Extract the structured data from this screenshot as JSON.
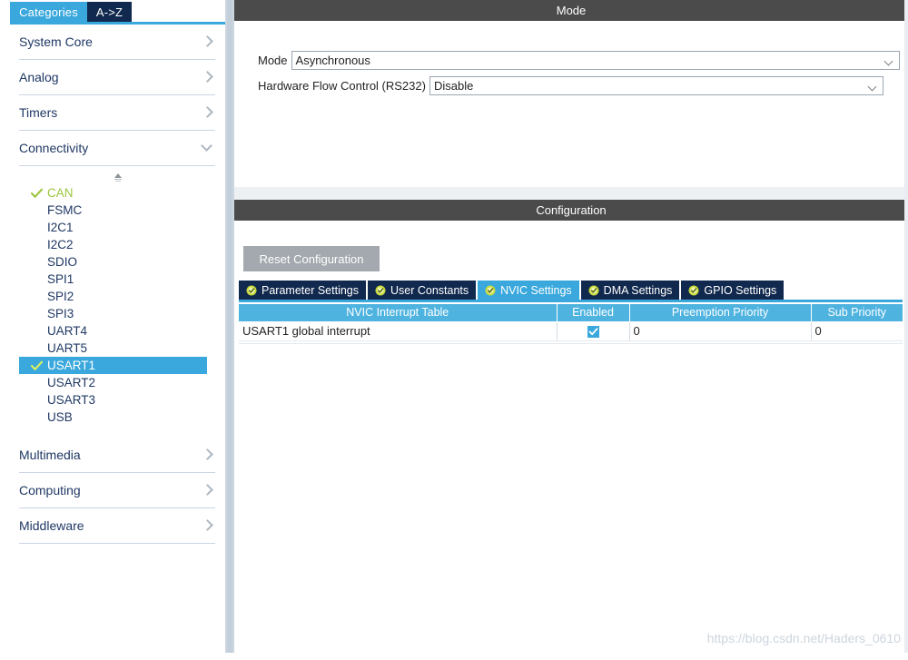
{
  "left_pane": {
    "tabs": [
      {
        "label": "Categories",
        "active": true
      },
      {
        "label": "A->Z",
        "active": false
      }
    ],
    "categories_top": [
      {
        "label": "System Core",
        "expanded": false
      },
      {
        "label": "Analog",
        "expanded": false
      },
      {
        "label": "Timers",
        "expanded": false
      },
      {
        "label": "Connectivity",
        "expanded": true
      }
    ],
    "peripherals": [
      {
        "label": "CAN",
        "state": "configured",
        "selected": false
      },
      {
        "label": "FSMC",
        "state": "none",
        "selected": false
      },
      {
        "label": "I2C1",
        "state": "none",
        "selected": false
      },
      {
        "label": "I2C2",
        "state": "none",
        "selected": false
      },
      {
        "label": "SDIO",
        "state": "none",
        "selected": false
      },
      {
        "label": "SPI1",
        "state": "none",
        "selected": false
      },
      {
        "label": "SPI2",
        "state": "none",
        "selected": false
      },
      {
        "label": "SPI3",
        "state": "none",
        "selected": false
      },
      {
        "label": "UART4",
        "state": "none",
        "selected": false
      },
      {
        "label": "UART5",
        "state": "none",
        "selected": false
      },
      {
        "label": "USART1",
        "state": "configured",
        "selected": true
      },
      {
        "label": "USART2",
        "state": "none",
        "selected": false
      },
      {
        "label": "USART3",
        "state": "none",
        "selected": false
      },
      {
        "label": "USB",
        "state": "none",
        "selected": false
      }
    ],
    "categories_bottom": [
      {
        "label": "Multimedia",
        "expanded": false
      },
      {
        "label": "Computing",
        "expanded": false
      },
      {
        "label": "Middleware",
        "expanded": false
      }
    ],
    "scroll_up_icon": "scroll-up-icon"
  },
  "mode_panel": {
    "title": "Mode",
    "fields": [
      {
        "label": "Mode",
        "value": "Asynchronous"
      },
      {
        "label": "Hardware Flow Control (RS232)",
        "value": "Disable"
      }
    ]
  },
  "config_panel": {
    "title": "Configuration",
    "reset_label": "Reset Configuration",
    "tabs": [
      {
        "label": "Parameter Settings",
        "active": false
      },
      {
        "label": "User Constants",
        "active": false
      },
      {
        "label": "NVIC Settings",
        "active": true
      },
      {
        "label": "DMA Settings",
        "active": false
      },
      {
        "label": "GPIO Settings",
        "active": false
      }
    ],
    "table": {
      "headers": [
        "NVIC Interrupt Table",
        "Enabled",
        "Preemption Priority",
        "Sub Priority"
      ],
      "rows": [
        {
          "name": "USART1 global interrupt",
          "enabled": true,
          "preemption_priority": "0",
          "sub_priority": "0"
        }
      ]
    }
  },
  "watermark": {
    "text": "https://blog.csdn.net/Haders_0610"
  },
  "colors": {
    "accent_blue": "#3aa8dc",
    "tab_navy": "#11294e",
    "panel_header_gray": "#4b4b4b",
    "check_green": "#9bc53d",
    "table_header_blue": "#4fb3e0"
  }
}
